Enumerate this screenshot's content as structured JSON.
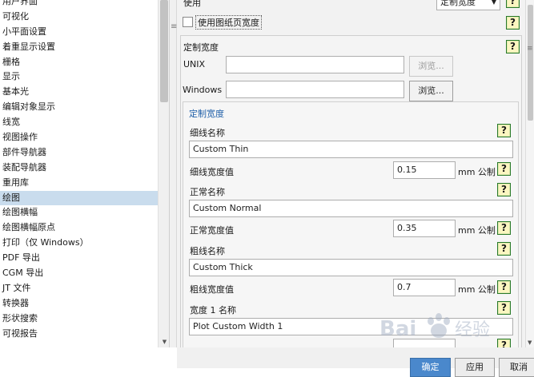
{
  "sidebar": {
    "items": [
      {
        "label": "用户界面"
      },
      {
        "label": "可视化"
      },
      {
        "label": "小平面设置"
      },
      {
        "label": "着重显示设置"
      },
      {
        "label": "栅格"
      },
      {
        "label": "显示"
      },
      {
        "label": "基本光"
      },
      {
        "label": "编辑对象显示"
      },
      {
        "label": "线宽"
      },
      {
        "label": "视图操作"
      },
      {
        "label": "部件导航器"
      },
      {
        "label": "装配导航器"
      },
      {
        "label": "重用库"
      },
      {
        "label": "绘图",
        "selected": true
      },
      {
        "label": "绘图横幅"
      },
      {
        "label": "绘图横幅原点"
      },
      {
        "label": "打印（仅 Windows）"
      },
      {
        "label": "PDF 导出"
      },
      {
        "label": "CGM 导出"
      },
      {
        "label": "JT 文件"
      },
      {
        "label": "转换器"
      },
      {
        "label": "形状搜索"
      },
      {
        "label": "可视报告"
      }
    ]
  },
  "top": {
    "use_label": "使用",
    "use_select_value": "定制宽度",
    "use_paper_width_label": "使用图纸页宽度",
    "use_paper_width_checked": false
  },
  "custom_width": {
    "section_label": "定制宽度",
    "unix_label": "UNIX",
    "unix_value": "",
    "unix_browse": "浏览...",
    "windows_label": "Windows",
    "windows_value": "",
    "windows_browse": "浏览...",
    "group_title": "定制宽度",
    "thin_name_label": "细线名称",
    "thin_name_value": "Custom Thin",
    "thin_width_label": "细线宽度值",
    "thin_width_value": "0.15",
    "thin_unit": "mm 公制",
    "normal_name_label": "正常名称",
    "normal_name_value": "Custom Normal",
    "normal_width_label": "正常宽度值",
    "normal_width_value": "0.35",
    "normal_unit": "mm 公制",
    "thick_name_label": "粗线名称",
    "thick_name_value": "Custom Thick",
    "thick_width_label": "粗线宽度值",
    "thick_width_value": "0.7",
    "thick_unit": "mm 公制",
    "width1_name_label": "宽度 1 名称",
    "width1_name_value": "Plot Custom Width 1"
  },
  "help_icon_text": "?",
  "dialog_buttons": {
    "ok": "确定",
    "apply": "应用",
    "cancel": "取消"
  },
  "watermark": {
    "text": "Bai 经验"
  },
  "colors": {
    "selection": "#c9dced",
    "primary_button": "#4a88cc",
    "help_border": "#2a7a2a",
    "group_title": "#1f5fa8"
  }
}
